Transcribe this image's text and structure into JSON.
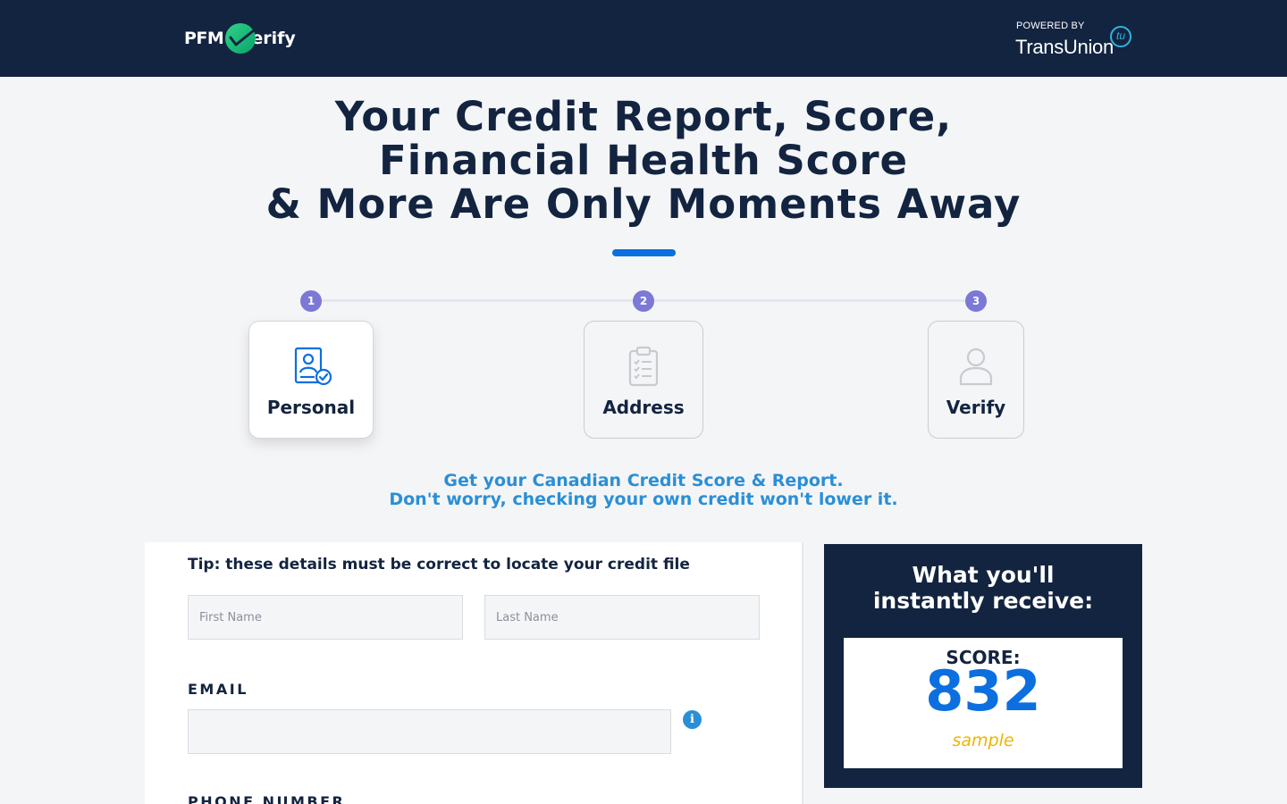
{
  "header": {
    "logo_left": "PFM",
    "logo_right": "erify",
    "powered_by": "POWERED BY",
    "partner": "TransUnion",
    "partner_badge": "tu"
  },
  "hero": {
    "title_lines": [
      "Your Credit Report, Score,",
      "Financial Health Score",
      "& More Are Only Moments Away"
    ]
  },
  "steps": [
    {
      "number": "1",
      "label": "Personal",
      "icon": "personal-id-icon",
      "active": true
    },
    {
      "number": "2",
      "label": "Address",
      "icon": "clipboard-checklist-icon",
      "active": false
    },
    {
      "number": "3",
      "label": "Verify",
      "icon": "user-icon",
      "active": false
    }
  ],
  "subtext": {
    "line1": "Get your Canadian Credit Score & Report.",
    "line2": "Don't worry, checking your own credit won't lower it."
  },
  "form": {
    "tip": "Tip: these details must be correct to locate your credit file",
    "first_name": {
      "value": "",
      "placeholder": "First Name"
    },
    "last_name": {
      "value": "",
      "placeholder": "Last Name"
    },
    "email_label": "EMAIL",
    "email": {
      "value": "",
      "placeholder": ""
    },
    "info_icon": "i",
    "phone_label": "PHONE NUMBER"
  },
  "receive": {
    "title_line1": "What you'll",
    "title_line2": "instantly receive:",
    "score_label": "SCORE:",
    "score_value": "832",
    "score_note": "sample"
  },
  "colors": {
    "navy": "#132440",
    "accent_blue": "#0b6fe0",
    "link_blue": "#2a8fd6",
    "step_purple": "#7b78d6",
    "sample_gold": "#f0b400",
    "logo_green": "#2fd38a"
  }
}
